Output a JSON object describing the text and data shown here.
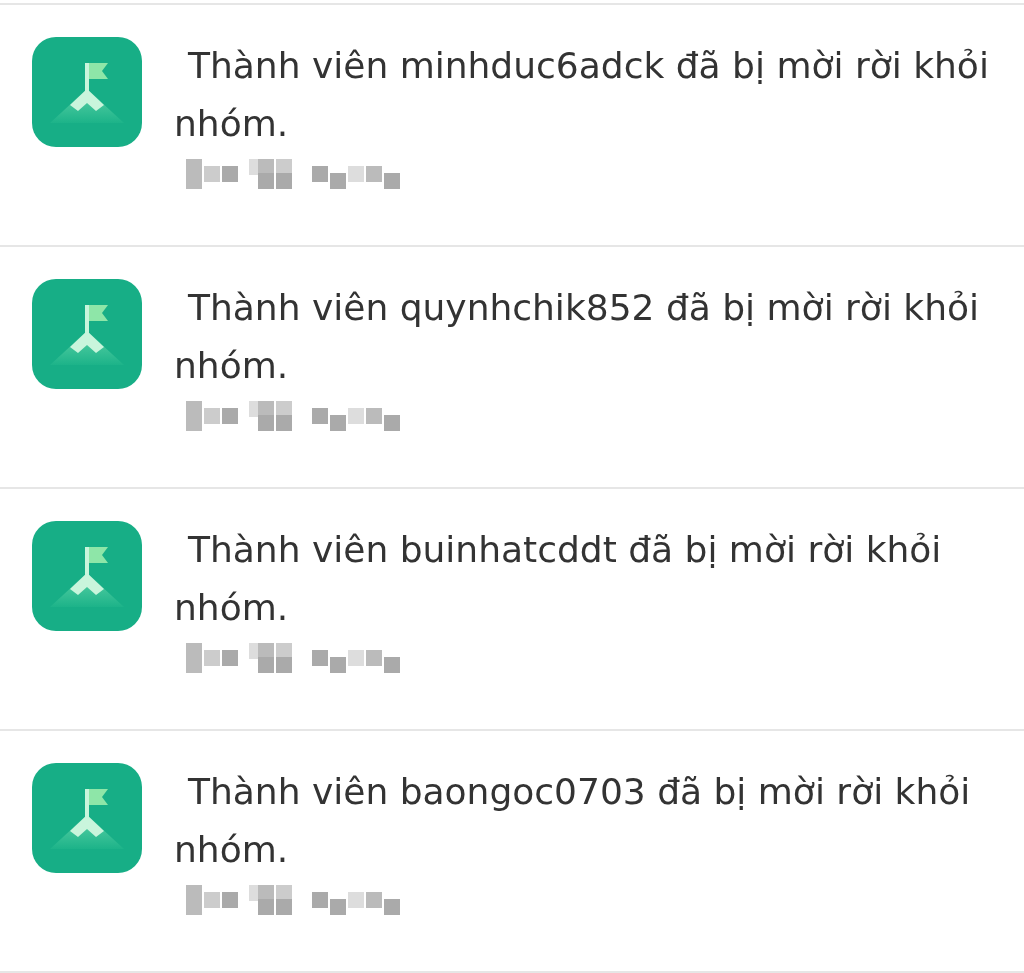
{
  "notifications": [
    {
      "message": "Thành viên minhduc6adck đã bị mời rời khỏi nhóm."
    },
    {
      "message": "Thành viên quynhchik852 đã bị mời rời khỏi nhóm."
    },
    {
      "message": "Thành viên buinhatcddt đã bị mời rời khỏi nhóm."
    },
    {
      "message": "Thành viên baongoc0703 đã bị mời rời khỏi nhóm."
    }
  ]
}
